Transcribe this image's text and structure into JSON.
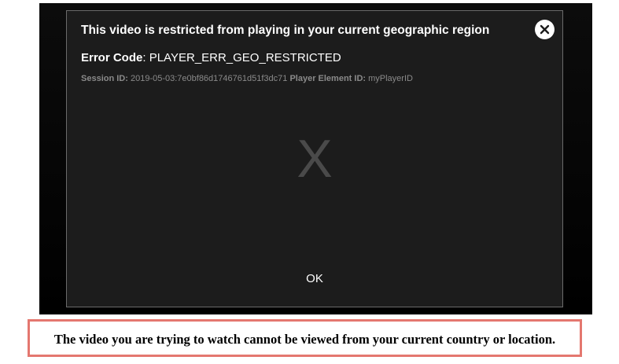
{
  "dialog": {
    "title": "This video is restricted from playing in your current geographic region",
    "error_code_label": "Error Code",
    "error_code_sep": ": ",
    "error_code_value": "PLAYER_ERR_GEO_RESTRICTED",
    "session_label": "Session ID:",
    "session_value": "2019-05-03:7e0bf86d1746761d51f3dc71",
    "player_element_label": "Player Element ID:",
    "player_element_value": "myPlayerID",
    "placeholder_glyph": "X",
    "ok_label": "OK",
    "close_icon": "close-icon"
  },
  "caption": {
    "text": "The video you are trying to watch cannot be viewed from your current country or location."
  },
  "colors": {
    "dialog_bg": "#1c1c1c",
    "caption_border": "#e4776f"
  }
}
